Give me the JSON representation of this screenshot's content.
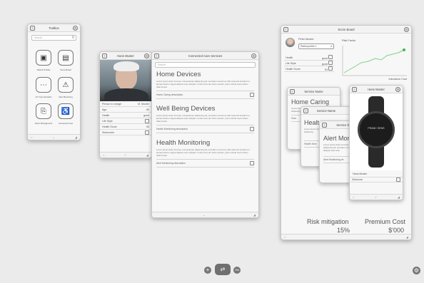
{
  "toolbox": {
    "title": "Toolbox",
    "search_placeholder": "Search",
    "tools": [
      {
        "label": "Patient Profiles",
        "icon": "contact-card-icon"
      },
      {
        "label": "Score Board",
        "icon": "phone-device-icon"
      },
      {
        "label": "IoT Care Assistant",
        "icon": "assistant-icon"
      },
      {
        "label": "Alert Monitoring",
        "icon": "warning-triangle-icon"
      },
      {
        "label": "Alarm Management",
        "icon": "clipboard-icon"
      },
      {
        "label": "Connected Care",
        "icon": "care-bed-icon"
      }
    ]
  },
  "patient_card": {
    "title": "Hans Muster",
    "rows": [
      {
        "label": "Person in charge",
        "value": "M. Muster"
      },
      {
        "label": "Age",
        "value": "80"
      },
      {
        "label": "Health",
        "value": "good"
      },
      {
        "label": "Life Style",
        "value": ""
      },
      {
        "label": "Health Score",
        "value": "53"
      },
      {
        "label": "Subscores",
        "value": ""
      }
    ]
  },
  "connected_care": {
    "title": "Connected Care Services",
    "search_placeholder": "Search",
    "sections": [
      {
        "heading": "Home Devices",
        "body": "Lorem ipsum dolor sit amet, consectetuer adipiscing elit, sed diam nonummy nibh euismod tincidunt ut laoreet dolore magna aliquam erat volutpat. Ut wisi enim ad minim veniam, quis nostrud exerci tation ullamcorper.",
        "description": "Home Caring description"
      },
      {
        "heading": "Well Being Devices",
        "body": "Lorem ipsum dolor sit amet, consectetuer adipiscing elit, sed diam nonummy nibh euismod tincidunt ut laoreet dolore magna aliquam erat volutpat. Ut wisi enim ad minim veniam, quis nostrud exerci tation ullamcorper.",
        "description": "Health Monitoring description"
      },
      {
        "heading": "Health Monitoring",
        "body": "Lorem ipsum dolor sit amet, consectetuer adipiscing elit, sed diam nonummy nibh euismod tincidunt ut laoreet dolore magna aliquam erat volutpat. Ut wisi enim ad minim veniam, quis nostrud exerci tation ullamcorper.",
        "description": "Alert Monitoring description"
      }
    ]
  },
  "scoreboard": {
    "title": "Score Board",
    "patient_name": "Peter Muster",
    "profile_select": "Risikoprofile 1",
    "rows": [
      {
        "label": "Health",
        "value": "good"
      },
      {
        "label": "Life Style",
        "value": "good"
      },
      {
        "label": "Health Score",
        "value": "53"
      }
    ],
    "chart_label": "Risk Factor",
    "chart_axis_label": "Insurance Cost",
    "risk_label": "Risk mitigation",
    "risk_value": "15%",
    "premium_label": "Premium Cost",
    "premium_value": "$'000"
  },
  "service_a": {
    "title": "Service Name",
    "heading": "Home Caring",
    "lorem": "Lorem ipsum dolor sit amet, consectetuer adipiscing elit, sed diam nonummy",
    "footer": "Hom"
  },
  "service_b": {
    "title": "Service Name",
    "heading": "Healt",
    "lorem": "Lorem ipsum dolor sit amet, consectetuer adipiscing",
    "description": "Health Serv"
  },
  "service_c": {
    "title": "Service Name",
    "heading": "Alert Mon",
    "lorem": "Lorem ipsum dolor sit amet, consectetuer adipiscing elit, sed diam nonummy nibh euismod aliquam erat volut",
    "description": "Alert Monitoring de"
  },
  "device_card": {
    "title": "Hans Muster",
    "brand": "FRANC SENS",
    "name": "Hans Muster",
    "subscore_label": "Subscore"
  },
  "bottom_bar": {
    "add": "+",
    "center": "⇄",
    "text": "Aa"
  }
}
